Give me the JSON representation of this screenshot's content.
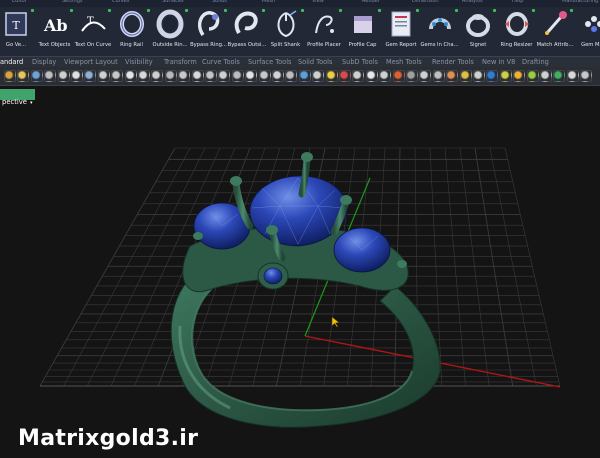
{
  "app": {
    "top_strip": [
      "Editor",
      "Settings",
      "Curves",
      "Surfaces",
      "Solids",
      "Mesh",
      "View",
      "Render",
      "Dimension",
      "Analysis",
      "Help",
      "Manufacturing"
    ]
  },
  "ribbon": {
    "buttons": [
      {
        "label": "Go Ve...",
        "icon": "text-frame-icon"
      },
      {
        "label": "Text Objects",
        "icon": "text-ab-icon"
      },
      {
        "label": "Text On Curve",
        "icon": "text-on-curve-icon"
      },
      {
        "label": "Ring Rail",
        "icon": "ring-rail-icon"
      },
      {
        "label": "Outside Rin...",
        "icon": "outside-ring-icon"
      },
      {
        "label": "Bypass Ring...",
        "icon": "bypass-ring-icon"
      },
      {
        "label": "Bypass Outsi...",
        "icon": "bypass-outside-icon"
      },
      {
        "label": "Split Shank",
        "icon": "split-shank-icon"
      },
      {
        "label": "Profile Placer",
        "icon": "profile-placer-icon"
      },
      {
        "label": "Profile Cap",
        "icon": "profile-cap-icon"
      },
      {
        "label": "Gem Report",
        "icon": "gem-report-icon"
      },
      {
        "label": "Gems In Cha...",
        "icon": "gems-in-channel-icon"
      },
      {
        "label": "Signet",
        "icon": "signet-ring-icon"
      },
      {
        "label": "Ring Resizer",
        "icon": "ring-resizer-icon"
      },
      {
        "label": "Match Attrib...",
        "icon": "match-attributes-icon"
      },
      {
        "label": "Gem Map",
        "icon": "gem-map-icon"
      }
    ]
  },
  "tabs": [
    "andard",
    "Display",
    "Viewport Layout",
    "Visibility",
    "Transform",
    "Curve Tools",
    "Surface Tools",
    "Solid Tools",
    "SubD Tools",
    "Mesh Tools",
    "Render Tools",
    "New in V8",
    "Drafting"
  ],
  "active_tab": 0,
  "viewport": {
    "name": "pective",
    "arrow": "▾"
  },
  "watermark": "Matrixgold3.ir",
  "colors": {
    "ring": "#2e5c48",
    "gem": "#1f3b9c",
    "grid": "#3a3a3a",
    "x_axis": "#b01616",
    "y_axis": "#1a9a1a",
    "viewport_tab": "#3fa36b"
  }
}
